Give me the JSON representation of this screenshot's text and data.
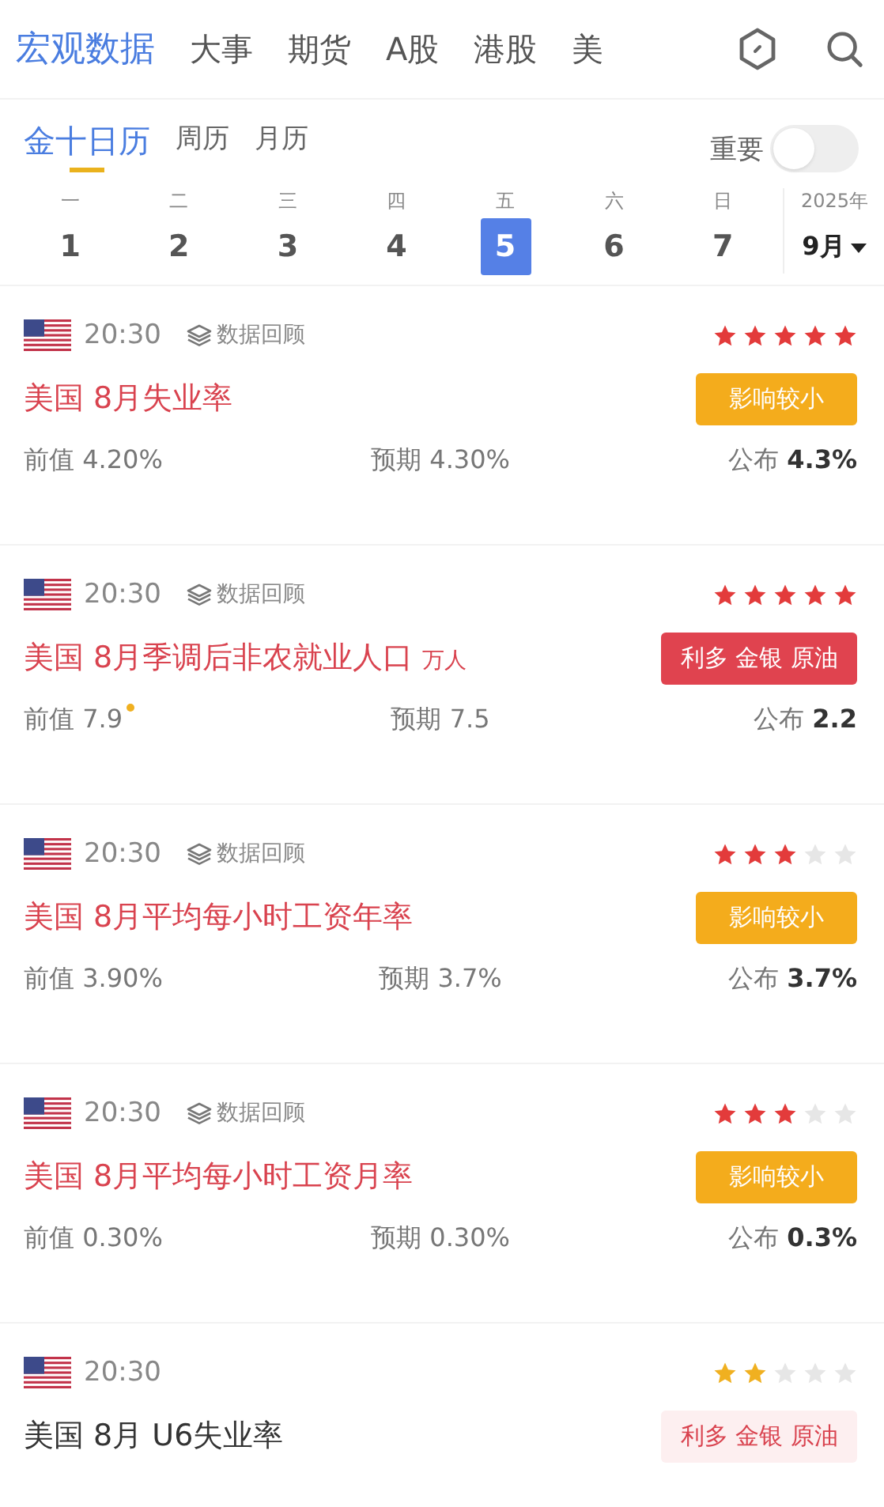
{
  "nav": {
    "tabs": [
      {
        "label": "宏观数据",
        "selected": true
      },
      {
        "label": "大事",
        "selected": false
      },
      {
        "label": "期货",
        "selected": false
      },
      {
        "label": "A股",
        "selected": false
      },
      {
        "label": "港股",
        "selected": false
      },
      {
        "label": "美",
        "selected": false
      }
    ]
  },
  "subtabs": [
    {
      "label": "金十日历",
      "selected": true
    },
    {
      "label": "周历",
      "selected": false
    },
    {
      "label": "月历",
      "selected": false
    }
  ],
  "important_filter": {
    "label": "重要",
    "on": false
  },
  "calendar": {
    "days": [
      {
        "weekday": "一",
        "day": "1",
        "selected": false
      },
      {
        "weekday": "二",
        "day": "2",
        "selected": false
      },
      {
        "weekday": "三",
        "day": "3",
        "selected": false
      },
      {
        "weekday": "四",
        "day": "4",
        "selected": false
      },
      {
        "weekday": "五",
        "day": "5",
        "selected": true
      },
      {
        "weekday": "六",
        "day": "6",
        "selected": false
      },
      {
        "weekday": "日",
        "day": "7",
        "selected": false
      }
    ],
    "year": "2025年",
    "month": "9月"
  },
  "events": [
    {
      "time": "20:30",
      "review": "数据回顾",
      "stars": 5,
      "title": "美国 8月失业率",
      "highlight": true,
      "tag": {
        "kind": "minor",
        "text": "影响较小"
      },
      "previous": {
        "label": "前值",
        "value": "4.20%",
        "revised": false
      },
      "forecast": {
        "label": "预期",
        "value": "4.30%"
      },
      "actual": {
        "label": "公布",
        "value": "4.3%"
      }
    },
    {
      "time": "20:30",
      "review": "数据回顾",
      "stars": 5,
      "title": "美国 8月季调后非农就业人口",
      "unit": "万人",
      "highlight": true,
      "tag": {
        "kind": "bullish",
        "text": "利多 金银 原油"
      },
      "previous": {
        "label": "前值",
        "value": "7.9",
        "revised": true
      },
      "forecast": {
        "label": "预期",
        "value": "7.5"
      },
      "actual": {
        "label": "公布",
        "value": "2.2"
      }
    },
    {
      "time": "20:30",
      "review": "数据回顾",
      "stars": 3,
      "title": "美国 8月平均每小时工资年率",
      "highlight": true,
      "tag": {
        "kind": "minor",
        "text": "影响较小"
      },
      "previous": {
        "label": "前值",
        "value": "3.90%",
        "revised": false
      },
      "forecast": {
        "label": "预期",
        "value": "3.7%"
      },
      "actual": {
        "label": "公布",
        "value": "3.7%"
      }
    },
    {
      "time": "20:30",
      "review": "数据回顾",
      "stars": 3,
      "title": "美国 8月平均每小时工资月率",
      "highlight": true,
      "tag": {
        "kind": "minor",
        "text": "影响较小"
      },
      "previous": {
        "label": "前值",
        "value": "0.30%",
        "revised": false
      },
      "forecast": {
        "label": "预期",
        "value": "0.30%"
      },
      "actual": {
        "label": "公布",
        "value": "0.3%"
      }
    },
    {
      "time": "20:30",
      "stars": 2,
      "title": "美国 8月 U6失业率",
      "highlight": false,
      "tag": {
        "kind": "bullish-soft",
        "text": "利多 金银 原油"
      }
    }
  ]
}
